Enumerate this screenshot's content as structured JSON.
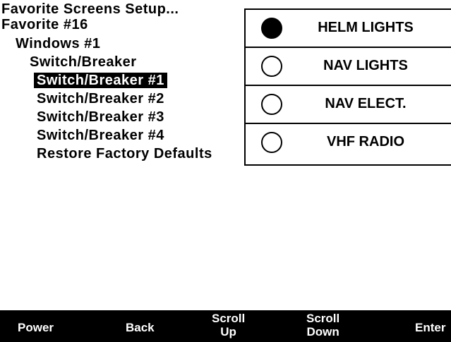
{
  "menu": {
    "title": "Favorite Screens Setup...",
    "favorite": "Favorite #16",
    "windows": "Windows #1",
    "switch_breaker": "Switch/Breaker",
    "items": [
      "Switch/Breaker #1",
      "Switch/Breaker #2",
      "Switch/Breaker #3",
      "Switch/Breaker #4",
      "Restore Factory Defaults"
    ],
    "selected_index": 0
  },
  "panel": {
    "rows": [
      {
        "label": "HELM LIGHTS",
        "selected": true
      },
      {
        "label": "NAV LIGHTS",
        "selected": false
      },
      {
        "label": "NAV ELECT.",
        "selected": false
      },
      {
        "label": "VHF RADIO",
        "selected": false
      }
    ]
  },
  "softkeys": {
    "power": "Power",
    "back": "Back",
    "scroll_up_1": "Scroll",
    "scroll_up_2": "Up",
    "scroll_down_1": "Scroll",
    "scroll_down_2": "Down",
    "enter": "Enter"
  }
}
